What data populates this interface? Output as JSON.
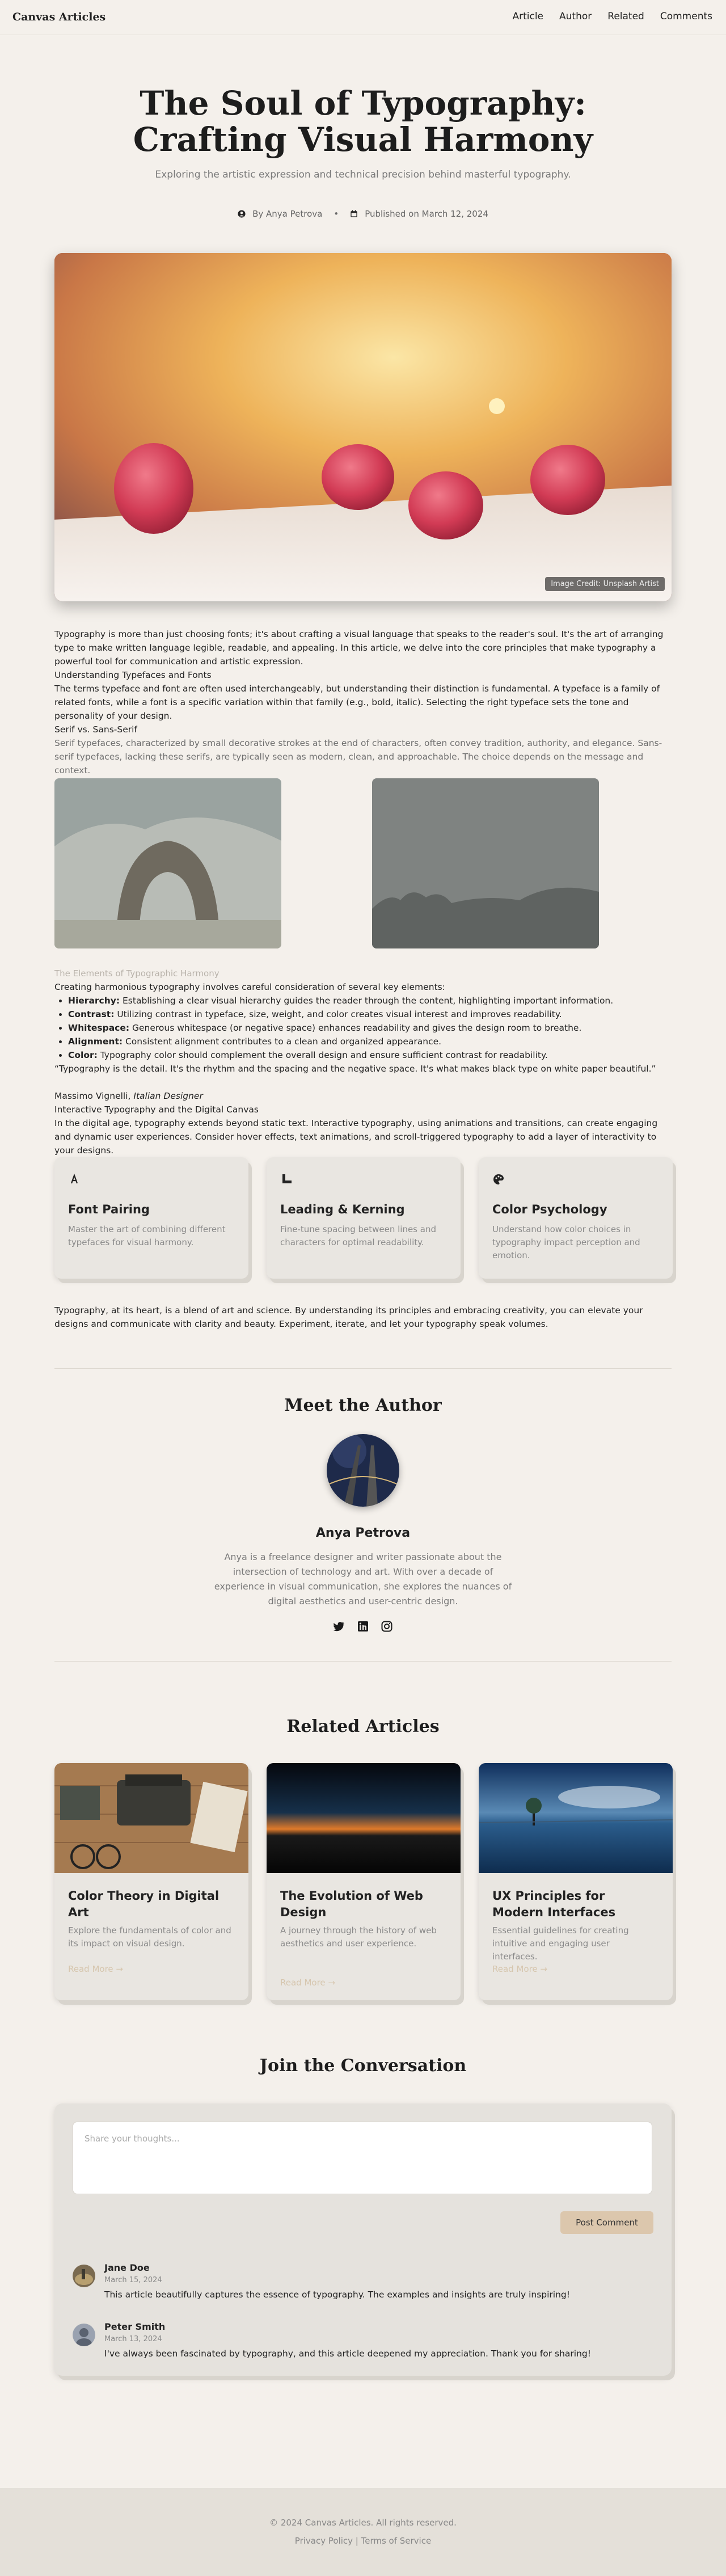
{
  "nav": {
    "brand": "Canvas Articles",
    "links": [
      "Article",
      "Author",
      "Related",
      "Comments"
    ]
  },
  "hero": {
    "title": "The Soul of Typography: Crafting Visual Harmony",
    "subtitle": "Exploring the artistic expression and technical precision behind masterful typography.",
    "author": "By Anya Petrova",
    "separator": "•",
    "published": "Published on March 12, 2024",
    "image_credit": "Image Credit: Unsplash Artist"
  },
  "article": {
    "intro": "Typography is more than just choosing fonts; it's about crafting a visual language that speaks to the reader's soul. It's the art of arranging type to make written language legible, readable, and appealing. In this article, we delve into the core principles that make typography a powerful tool for communication and artistic expression.",
    "h_understanding": "Understanding Typefaces and Fonts",
    "p_understanding": "The terms typeface and font are often used interchangeably, but understanding their distinction is fundamental. A typeface is a family of related fonts, while a font is a specific variation within that family (e.g., bold, italic). Selecting the right typeface sets the tone and personality of your design.",
    "h_serif": "Serif vs. Sans-Serif",
    "p_serif": "Serif typefaces, characterized by small decorative strokes at the end of characters, often convey tradition, authority, and elegance. Sans-serif typefaces, lacking these serifs, are typically seen as modern, clean, and approachable. The choice depends on the message and context.",
    "image_caption": "The Elements of Typographic Harmony",
    "p_elements": "Creating harmonious typography involves careful consideration of several key elements:",
    "list": [
      {
        "term": "Hierarchy:",
        "text": " Establishing a clear visual hierarchy guides the reader through the content, highlighting important information."
      },
      {
        "term": "Contrast:",
        "text": " Utilizing contrast in typeface, size, weight, and color creates visual interest and improves readability."
      },
      {
        "term": "Whitespace:",
        "text": " Generous whitespace (or negative space) enhances readability and gives the design room to breathe."
      },
      {
        "term": "Alignment:",
        "text": " Consistent alignment contributes to a clean and organized appearance."
      },
      {
        "term": "Color:",
        "text": " Typography color should complement the overall design and ensure sufficient contrast for readability."
      }
    ],
    "quote": "“Typography is the detail. It's the rhythm and the spacing and the negative space. It's what makes black type on white paper beautiful.”",
    "quote_author": "Massimo Vignelli, ",
    "quote_role": "Italian Designer",
    "h_interactive": "Interactive Typography and the Digital Canvas",
    "p_interactive": "In the digital age, typography extends beyond static text. Interactive typography, using animations and transitions, can create engaging and dynamic user experiences. Consider hover effects, text animations, and scroll-triggered typography to add a layer of interactivity to your designs.",
    "conclusion": "Typography, at its heart, is a blend of art and science. By understanding its principles and embracing creativity, you can elevate your designs and communicate with clarity and beauty. Experiment, iterate, and let your typography speak volumes."
  },
  "features": [
    {
      "icon": "font-icon",
      "title": "Font Pairing",
      "desc": "Master the art of combining different typefaces for visual harmony."
    },
    {
      "icon": "ruler-icon",
      "title": "Leading & Kerning",
      "desc": "Fine-tune spacing between lines and characters for optimal readability."
    },
    {
      "icon": "palette-icon",
      "title": "Color Psychology",
      "desc": "Understand how color choices in typography impact perception and emotion."
    }
  ],
  "author_section": {
    "heading": "Meet the Author",
    "name": "Anya Petrova",
    "bio": "Anya is a freelance designer and writer passionate about the intersection of technology and art. With over a decade of experience in visual communication, she explores the nuances of digital aesthetics and user-centric design.",
    "social_icons": [
      "twitter-icon",
      "linkedin-icon",
      "instagram-icon"
    ]
  },
  "related": {
    "heading": "Related Articles",
    "items": [
      {
        "title": "Color Theory in Digital Art",
        "desc": "Explore the fundamentals of color and its impact on visual design.",
        "more": "Read More →"
      },
      {
        "title": "The Evolution of Web Design",
        "desc": "A journey through the history of web aesthetics and user experience.",
        "more": "Read More →"
      },
      {
        "title": "UX Principles for Modern Interfaces",
        "desc": "Essential guidelines for creating intuitive and engaging user interfaces.",
        "more": "Read More →"
      }
    ]
  },
  "comments": {
    "heading": "Join the Conversation",
    "placeholder": "Share your thoughts...",
    "button": "Post Comment",
    "items": [
      {
        "name": "Jane Doe",
        "date": "March 15, 2024",
        "body": "This article beautifully captures the essence of typography. The examples and insights are truly inspiring!"
      },
      {
        "name": "Peter Smith",
        "date": "March 13, 2024",
        "body": "I've always been fascinated by typography, and this article deepened my appreciation. Thank you for sharing!"
      }
    ]
  },
  "footer": {
    "copyright": "© 2024 Canvas Articles. All rights reserved.",
    "links": "Privacy Policy | Terms of Service"
  },
  "colors": {
    "background": "#f4f0eb",
    "card": "#e9e6e1",
    "accent": "#dcc7ad",
    "muted_text": "#8a8a8a"
  }
}
